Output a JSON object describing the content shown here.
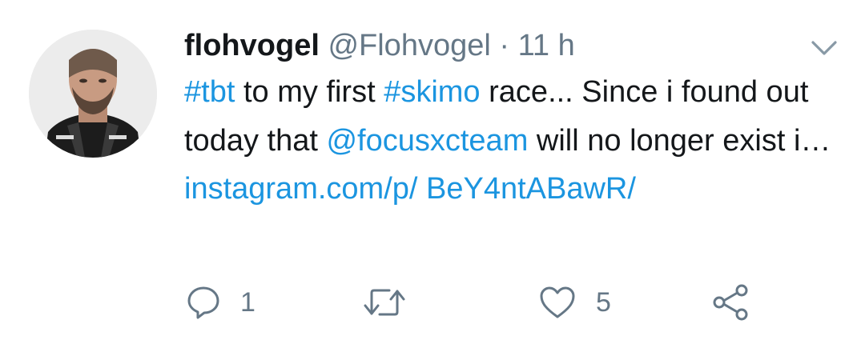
{
  "tweet": {
    "display_name": "flohvogel",
    "handle": "@Flohvogel",
    "separator": "·",
    "time": "11 h",
    "text": {
      "hashtag_1": "#tbt",
      "part_1": "to my first",
      "hashtag_2": "#skimo",
      "part_2": "race... Since i found out today that",
      "mention": "@focusxcteam",
      "part_3": "will no longer exist i…",
      "link": "instagram.com/p/ BeY4ntABawR/"
    }
  },
  "actions": {
    "reply_count": "1",
    "like_count": "5"
  },
  "icons": {
    "menu": "chevron-down-icon",
    "reply": "reply-icon",
    "retweet": "retweet-icon",
    "like": "heart-icon",
    "share": "share-icon"
  },
  "colors": {
    "link": "#1b95e0",
    "secondary_text": "#657786",
    "primary_text": "#14171a"
  }
}
